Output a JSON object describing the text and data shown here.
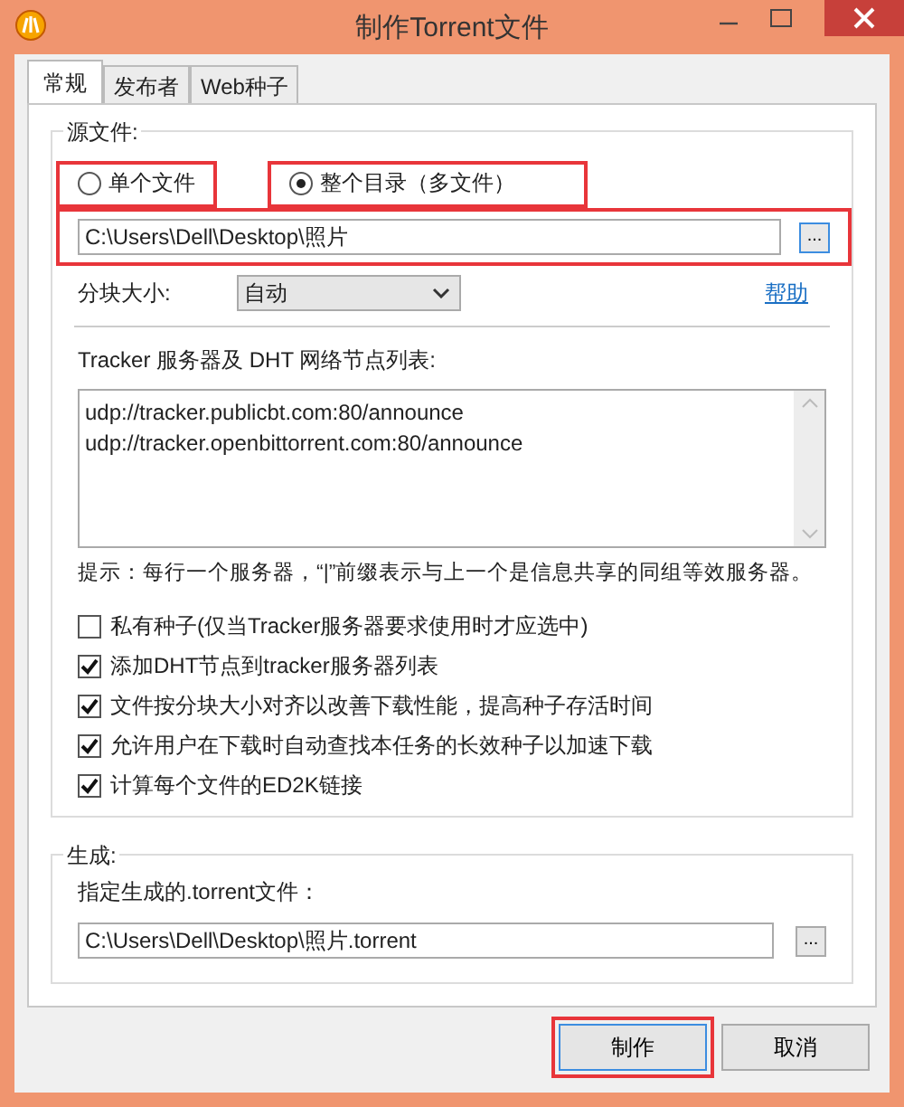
{
  "window": {
    "title": "制作Torrent文件"
  },
  "tabs": [
    {
      "label": "常规",
      "selected": true
    },
    {
      "label": "发布者",
      "selected": false
    },
    {
      "label": "Web种子",
      "selected": false
    }
  ],
  "source": {
    "legend": "源文件:",
    "modes": [
      {
        "label": "单个文件",
        "selected": false,
        "highlighted": true
      },
      {
        "label": "整个目录（多文件）",
        "selected": true,
        "highlighted": true
      }
    ],
    "path": {
      "value": "C:\\Users\\Dell\\Desktop\\照片",
      "highlighted": true
    },
    "browse": "...",
    "piece_size": {
      "label": "分块大小:",
      "value": "自动"
    },
    "help": "帮助",
    "trackers": {
      "label": "Tracker 服务器及 DHT 网络节点列表:",
      "lines": [
        "udp://tracker.publicbt.com:80/announce",
        "udp://tracker.openbittorrent.com:80/announce"
      ]
    },
    "hint": "提示：每行一个服务器，“|”前缀表示与上一个是信息共享的同组等效服务器。",
    "options": [
      {
        "label": "私有种子(仅当Tracker服务器要求使用时才应选中)",
        "checked": false
      },
      {
        "label": "添加DHT节点到tracker服务器列表",
        "checked": true
      },
      {
        "label": "文件按分块大小对齐以改善下载性能，提高种子存活时间",
        "checked": true
      },
      {
        "label": "允许用户在下载时自动查找本任务的长效种子以加速下载",
        "checked": true
      },
      {
        "label": "计算每个文件的ED2K链接",
        "checked": true
      }
    ]
  },
  "output": {
    "legend": "生成:",
    "label": "指定生成的.torrent文件：",
    "value": "C:\\Users\\Dell\\Desktop\\照片.torrent",
    "browse": "..."
  },
  "buttons": [
    {
      "label": "制作",
      "default": true,
      "highlighted": true
    },
    {
      "label": "取消",
      "default": false,
      "highlighted": false
    }
  ]
}
